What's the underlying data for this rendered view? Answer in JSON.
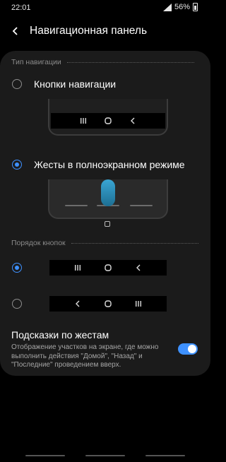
{
  "status_bar": {
    "time": "22:01",
    "battery": "56%"
  },
  "header": {
    "title": "Навигационная панель"
  },
  "navigation_type": {
    "section_title": "Тип навигации",
    "options": [
      {
        "label": "Кнопки навигации",
        "selected": false
      },
      {
        "label": "Жесты в полноэкранном режиме",
        "selected": true
      }
    ]
  },
  "button_order": {
    "section_title": "Порядок кнопок",
    "options": [
      {
        "selected": true,
        "icons": [
          "recent-apps-icon",
          "home-icon",
          "back-icon"
        ]
      },
      {
        "selected": false,
        "icons": [
          "back-icon",
          "home-icon",
          "recent-apps-icon"
        ]
      }
    ]
  },
  "gesture_hints": {
    "title": "Подсказки по жестам",
    "description": "Отображение участков на экране, где можно выполнить действия \"Домой\", \"Назад\" и \"Последние\" проведением вверх.",
    "enabled": true
  },
  "colors": {
    "accent": "#3e91ff",
    "card": "#1b1b1b",
    "background": "#000000"
  }
}
